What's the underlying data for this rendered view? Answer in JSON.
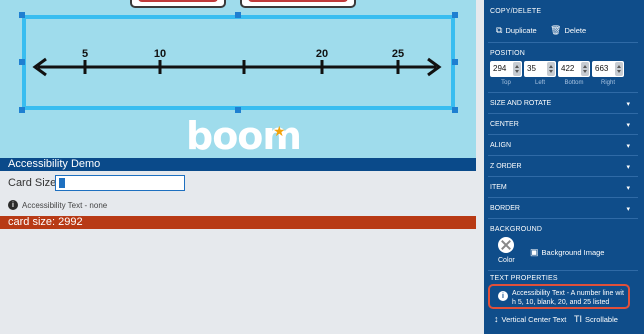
{
  "canvas": {
    "numberline_labels": [
      "5",
      "10",
      "20",
      "25"
    ],
    "logo_text": "boom"
  },
  "demo": {
    "bar_title": "Accessibility Demo",
    "card_size_label": "Card Size",
    "card_size_value": "",
    "a11y_text": "Accessibility Text - none",
    "status": "card size: 2992"
  },
  "panel": {
    "copy_delete": "COPY/DELETE",
    "duplicate": "Duplicate",
    "delete": "Delete",
    "position": "POSITION",
    "top_val": "294",
    "left_val": "35",
    "bottom_val": "422",
    "right_val": "663",
    "top_label": "Top",
    "left_label": "Left",
    "bottom_label": "Bottom",
    "right_label": "Right",
    "size_rotate": "SIZE AND ROTATE",
    "center": "CENTER",
    "align": "ALIGN",
    "z_order": "Z ORDER",
    "item": "ITEM",
    "border": "BORDER",
    "background": "BACKGROUND",
    "color": "Color",
    "background_image": "Background Image",
    "text_properties": "TEXT PROPERTIES",
    "a11y_text_line1": "Accessibility Text - A number line wit",
    "a11y_text_line2": "h 5, 10, blank, 20, and 25 listed",
    "vertical_center_text": "Vertical Center Text",
    "scrollable": "Scrollable"
  },
  "colors": {
    "canvas_bg": "#9fdcec",
    "selection": "#38bdf0",
    "panel_bg": "#0f4d8a",
    "demo_bar": "#0a4a8a",
    "status_bar": "#b83a15",
    "highlight": "#e0503a"
  }
}
